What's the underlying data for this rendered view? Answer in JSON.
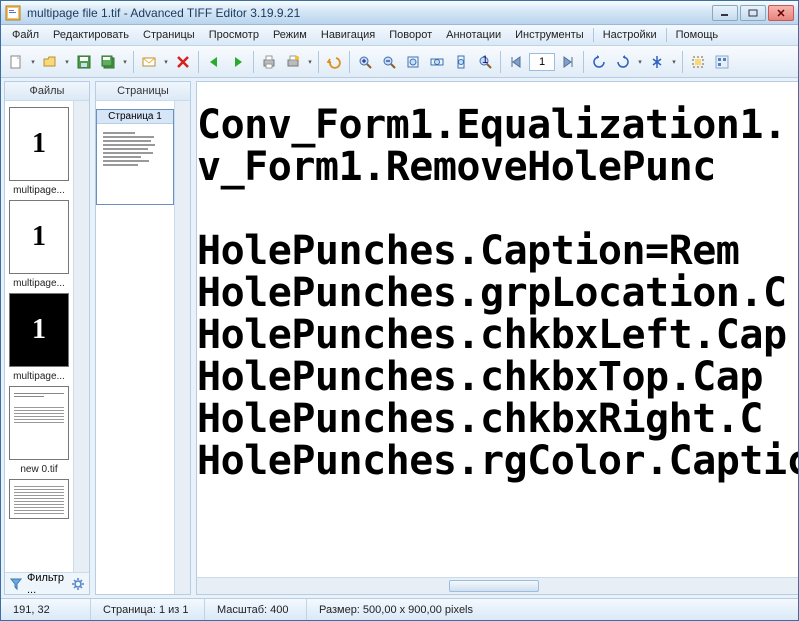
{
  "title": "multipage file 1.tif - Advanced TIFF Editor 3.19.9.21",
  "menu": [
    "Файл",
    "Редактировать",
    "Страницы",
    "Просмотр",
    "Режим",
    "Навигация",
    "Поворот",
    "Аннотации",
    "Инструменты",
    "Настройки",
    "Помощь"
  ],
  "toolbar": {
    "page_value": "1"
  },
  "panels": {
    "files": "Файлы",
    "pages": "Страницы"
  },
  "files": [
    {
      "label": "multipage...",
      "big": "1",
      "type": "white"
    },
    {
      "label": "multipage...",
      "big": "1",
      "type": "white"
    },
    {
      "label": "multipage...",
      "big": "1",
      "type": "black"
    },
    {
      "label": "new  0.tif",
      "type": "doc"
    },
    {
      "label": "",
      "type": "doc"
    }
  ],
  "filter": "Фильтр ...",
  "page_thumb_label": "Страница 1",
  "document_lines": [
    "Conv_Form1.Equalization1.",
    "v_Form1.RemoveHolePunc",
    "",
    "HolePunches.Caption=Rem",
    "HolePunches.grpLocation.C",
    "HolePunches.chkbxLeft.Cap",
    "HolePunches.chkbxTop.Cap",
    "HolePunches.chkbxRight.C",
    "HolePunches.rgColor.Captic"
  ],
  "status": {
    "coords": "191, 32",
    "page": "Страница: 1 из 1",
    "zoom": "Масштаб: 400",
    "size": "Размер: 500,00 x 900,00 pixels"
  },
  "icons": {
    "new": "new",
    "open": "open",
    "save": "save",
    "saveall": "saveall",
    "mail": "mail",
    "delete": "delete",
    "prev": "prev",
    "next": "next",
    "print": "print",
    "printer2": "printer2",
    "undo": "undo",
    "zoomin": "zoomin",
    "zoomout": "zoomout",
    "zoomfit": "zoomfit",
    "zoomw": "zoomw",
    "zoomh": "zoomh",
    "zoom1": "zoom1",
    "navfirst": "navfirst",
    "navlast": "navlast",
    "rotl": "rotl",
    "rotr": "rotr",
    "flip": "flip",
    "crop": "crop",
    "settings": "settings",
    "filter": "filter",
    "gear": "gear"
  }
}
